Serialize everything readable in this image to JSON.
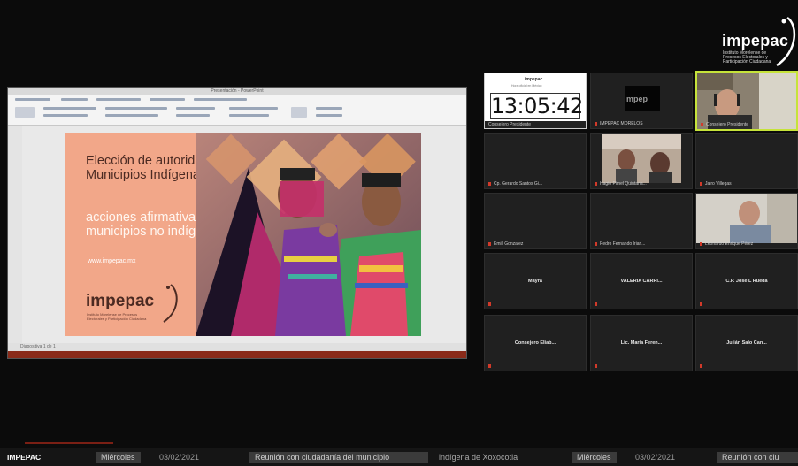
{
  "brand": {
    "name": "impepac",
    "subtitle": "Instituto Morelense de Procesos Electorales y Participación Ciudadana",
    "accent": "#f2a789"
  },
  "presentation": {
    "window_title": "Presentación - PowerPoint",
    "status": "Diapositiva 1 de 1",
    "slide": {
      "title_dark": "Elección de autoridades en Municipios Indígenas y",
      "title_light": "acciones afirmativas en municipios no indígenas",
      "url": "www.impepac.mx"
    }
  },
  "clock": {
    "time": "13:05:42",
    "brand": "impepac",
    "subtitle": "Hora oficial en México"
  },
  "participants": [
    {
      "name": "Cp. Gerardo Santos Gi..."
    },
    {
      "name": "Hagio Pimel Quintana..."
    },
    {
      "name": "Jairo Villegas"
    },
    {
      "name": "Emili Gonzalez"
    },
    {
      "name": "Pedro Fernando Irian..."
    },
    {
      "name": "Leonardo Enrique Pérez"
    },
    {
      "label": "Mayra"
    },
    {
      "label": "VALERIA CARRI..."
    },
    {
      "label": "C.P. José L Rueda"
    },
    {
      "label": "Consejero Eliab..."
    },
    {
      "label": "Lic. María Feren..."
    },
    {
      "label": "Julián Salo Can..."
    }
  ],
  "tile_impepac": {
    "label": "IMPEPAC MORELOS",
    "logo": "mpep"
  },
  "tile_active": {
    "label": "Consejero Presidente"
  },
  "clock_tile_label": "Consejero Presidente",
  "ticker": {
    "logo": "IMPEPAC",
    "day": "Miércoles",
    "date": "03/02/2021",
    "message": "Reunión con ciudadanía del municipio",
    "message2": "indígena de Xoxocotla",
    "day2": "Miércoles",
    "date2": "03/02/2021",
    "last": "Reunión con ciu"
  }
}
